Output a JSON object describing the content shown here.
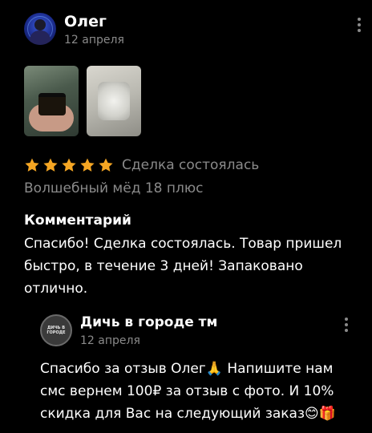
{
  "review": {
    "author_name": "Олег",
    "date": "12 апреля",
    "avatar_icon": "user-avatar-icon",
    "menu_icon": "more-vertical-icon",
    "photos": [
      {
        "alt": "jar-of-honey-photo"
      },
      {
        "alt": "packaged-item-photo"
      }
    ],
    "rating": 5,
    "max_rating": 5,
    "star_color": "#f5a623",
    "deal_status": "Сделка состоялась",
    "product": "Волшебный мёд 18 плюс",
    "comment_heading": "Комментарий",
    "comment_text": "Спасибо! Сделка состоялась. Товар пришел быстро, в течение 3 дней! Запаковано отлично."
  },
  "reply": {
    "seller_name": "Дичь в городе тм",
    "logo_text": "ДИЧЬ В ГОРОДЕ",
    "date": "12 апреля",
    "menu_icon": "more-vertical-icon",
    "text": "Спасибо за отзыв Олег🙏 Напишите нам смс вернем 100₽ за отзыв с фото. И 10% скидка для Вас на следующий заказ😊🎁"
  },
  "colors": {
    "background": "#000000",
    "primary_text": "#ffffff",
    "secondary_text": "#8a8a8a",
    "star": "#f5a623"
  }
}
